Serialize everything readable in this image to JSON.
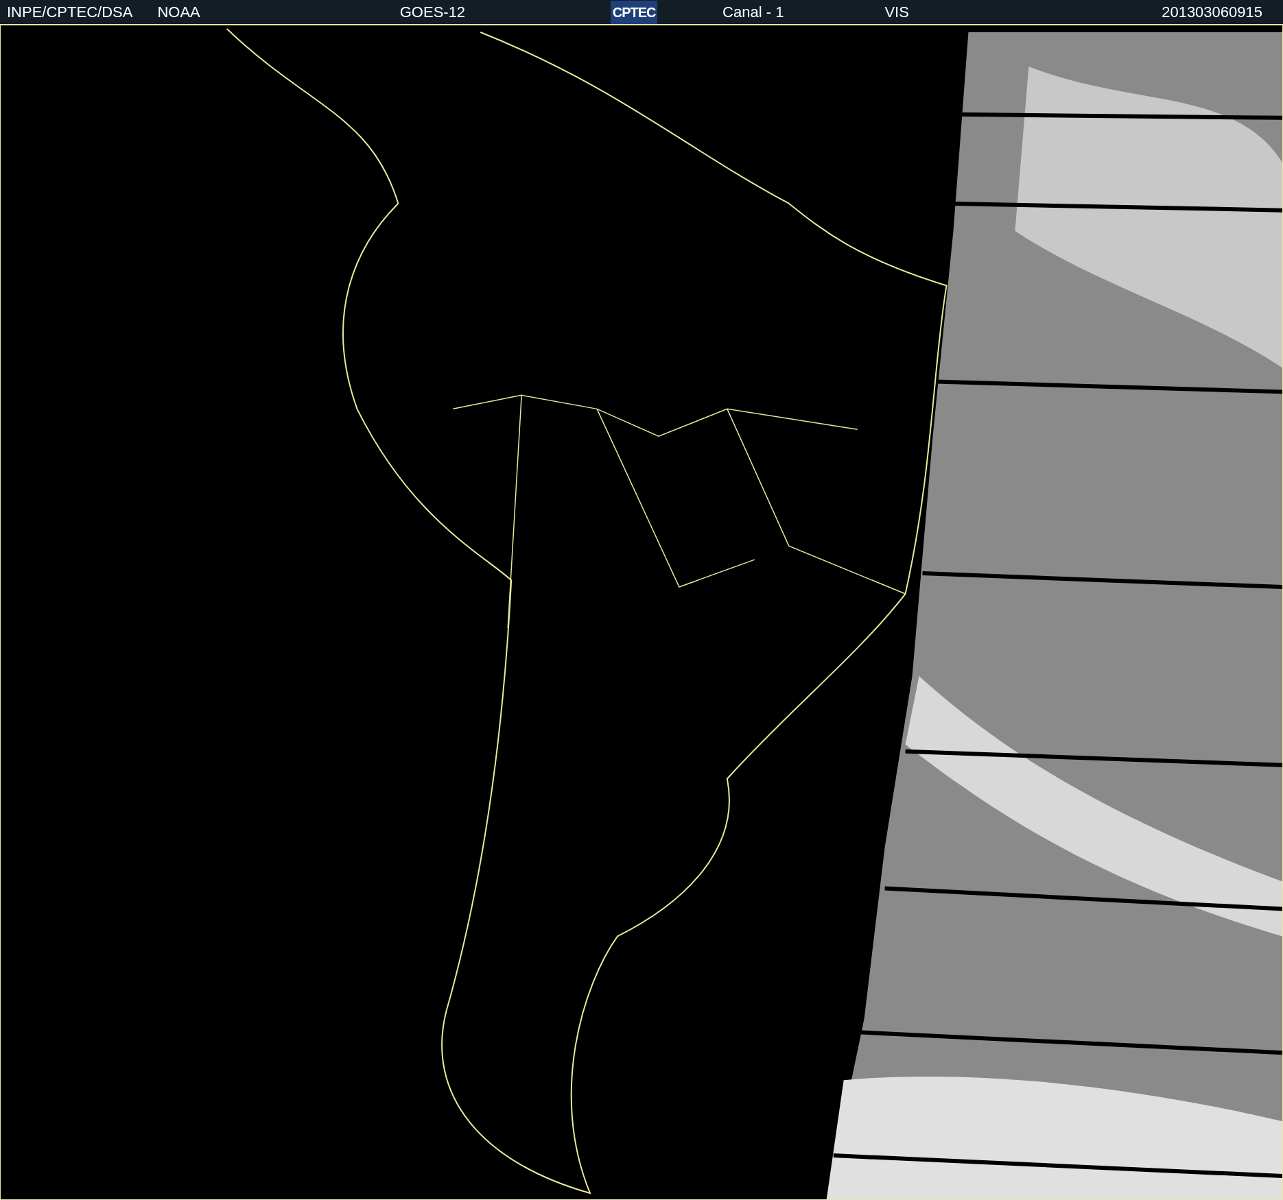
{
  "header": {
    "institution": "INPE/CPTEC/DSA",
    "agency": "NOAA",
    "satellite": "GOES-12",
    "logo": {
      "text": "CPTEC"
    },
    "channel": "Canal - 1",
    "band": "VIS",
    "timestamp": "201303060915"
  }
}
